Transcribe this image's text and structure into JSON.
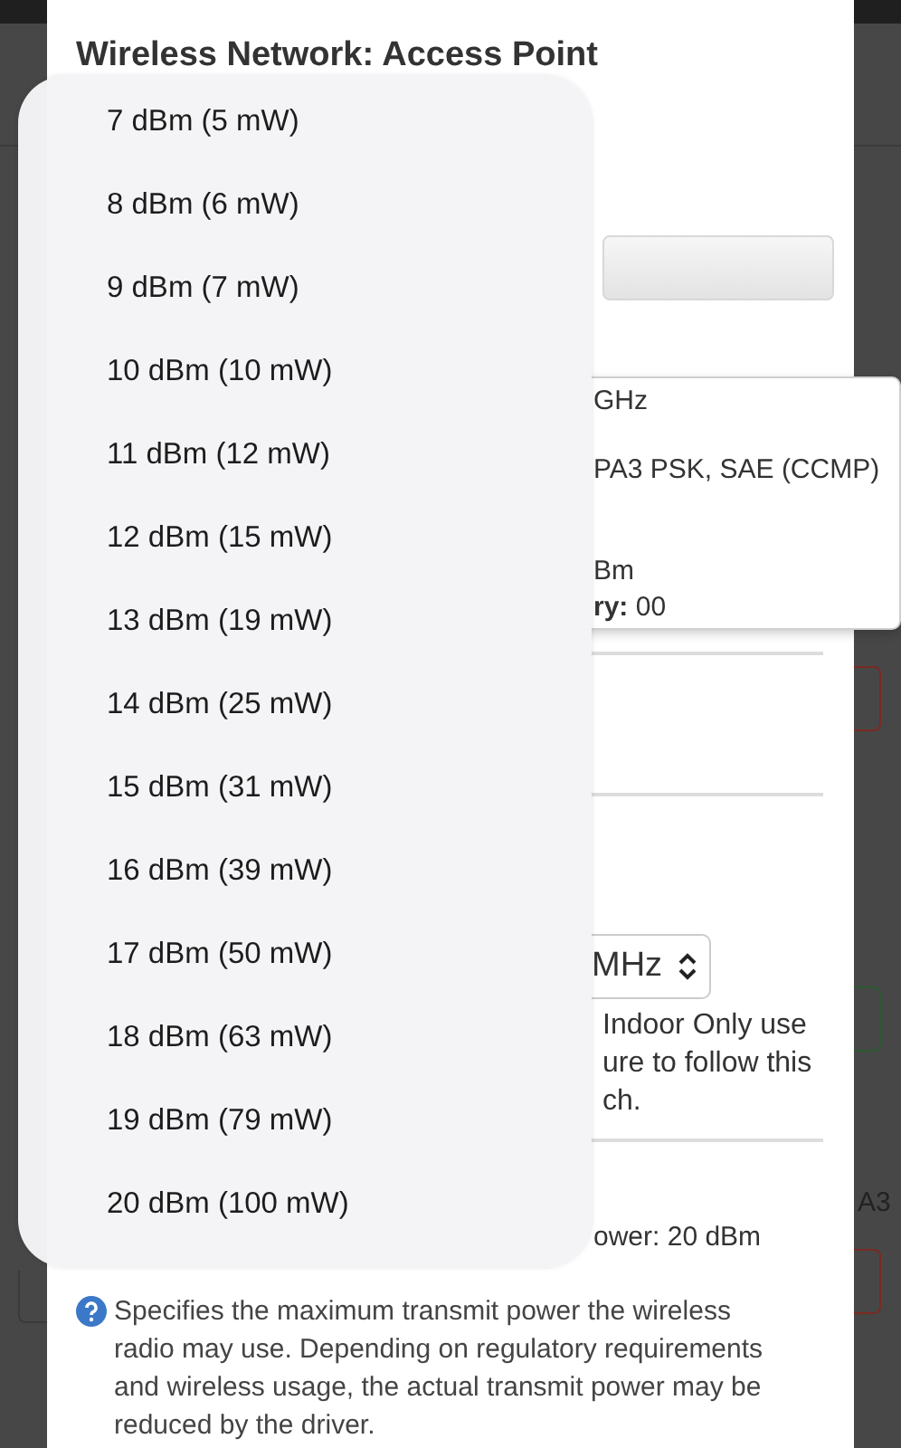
{
  "background_page": {
    "side_label": "A3"
  },
  "dialog": {
    "title": "Wireless Network: Access Point",
    "info_popup": {
      "lines": [
        "GHz",
        "PA3 PSK, SAE (CCMP)",
        "Bm",
        "**ry:** 00"
      ]
    },
    "width_select": {
      "value": "MHz"
    },
    "note_lines": [
      "Indoor Only use",
      "ure to follow this",
      "ch."
    ],
    "current_power": "ower: 20 dBm",
    "help_text": "Specifies the maximum transmit power the wireless radio may use. Depending on regulatory requirements and wireless usage, the actual transmit power may be reduced by the driver."
  },
  "dropdown": {
    "options": [
      {
        "label": "7 dBm (5 mW)"
      },
      {
        "label": "8 dBm (6 mW)"
      },
      {
        "label": "9 dBm (7 mW)"
      },
      {
        "label": "10 dBm (10 mW)"
      },
      {
        "label": "11 dBm (12 mW)"
      },
      {
        "label": "12 dBm (15 mW)"
      },
      {
        "label": "13 dBm (19 mW)"
      },
      {
        "label": "14 dBm (25 mW)"
      },
      {
        "label": "15 dBm (31 mW)"
      },
      {
        "label": "16 dBm (39 mW)"
      },
      {
        "label": "17 dBm (50 mW)"
      },
      {
        "label": "18 dBm (63 mW)"
      },
      {
        "label": "19 dBm (79 mW)"
      },
      {
        "label": "20 dBm (100 mW)"
      }
    ]
  }
}
